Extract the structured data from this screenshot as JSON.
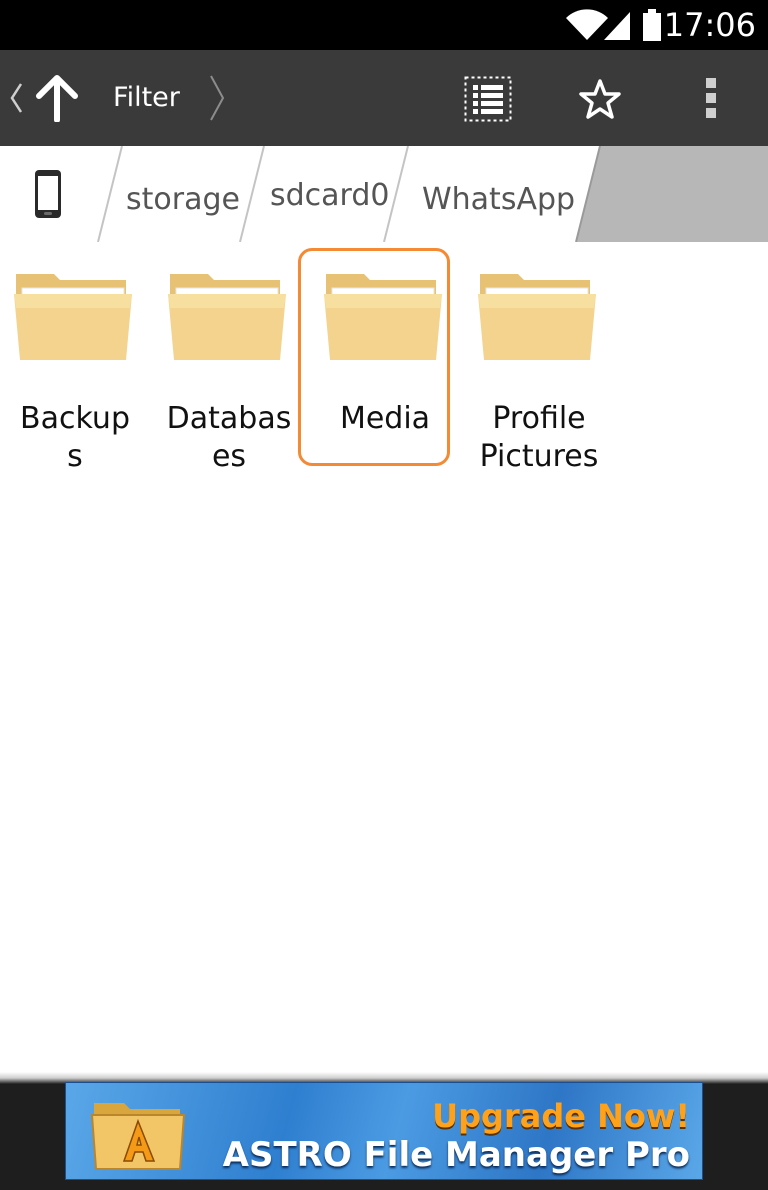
{
  "status_bar": {
    "time": "17:06",
    "icons": [
      "wifi-icon",
      "signal-icon",
      "battery-icon"
    ]
  },
  "action_bar": {
    "filter_label": "Filter",
    "icons": [
      "back-chevron-icon",
      "up-arrow-icon",
      "forward-chevron-icon",
      "list-view-icon",
      "star-icon",
      "overflow-menu-icon"
    ]
  },
  "breadcrumb": {
    "items": [
      {
        "label": ""
      },
      {
        "label": "storage"
      },
      {
        "label": "sdcard0"
      },
      {
        "label": "WhatsApp"
      }
    ]
  },
  "folders": [
    {
      "line1": "Backup",
      "line2": "s"
    },
    {
      "line1": "Databas",
      "line2": "es"
    },
    {
      "line1": "Media",
      "line2": ""
    },
    {
      "line1": "Profile",
      "line2": "Pictures"
    }
  ],
  "selected_folder": "Media",
  "ad": {
    "headline": "Upgrade Now!",
    "subline": "ASTRO File Manager Pro"
  },
  "colors": {
    "action_bar": "#3a3a3a",
    "breadcrumb_bg": "#b7b7b7",
    "selection": "#f58a35",
    "folder": "#f3d38d"
  }
}
